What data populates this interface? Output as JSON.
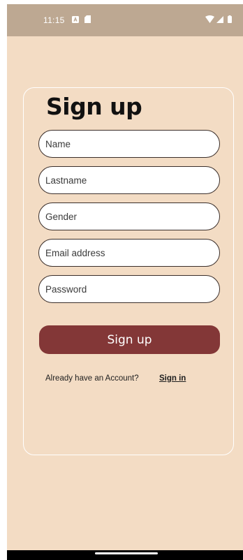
{
  "status_bar": {
    "time": "11:15",
    "icons": [
      "notification-a-icon",
      "sim-card-icon",
      "wifi-icon",
      "cellular-signal-icon",
      "battery-icon"
    ]
  },
  "form": {
    "title": "Sign up",
    "fields": {
      "name": {
        "placeholder": "Name",
        "value": ""
      },
      "lastname": {
        "placeholder": "Lastname",
        "value": ""
      },
      "gender": {
        "placeholder": "Gender",
        "value": ""
      },
      "email": {
        "placeholder": "Email address",
        "value": ""
      },
      "password": {
        "placeholder": "Password",
        "value": ""
      }
    },
    "submit_label": "Sign up",
    "footer_text": "Already have an Account?",
    "signin_label": "Sign in"
  },
  "colors": {
    "background": "#f3dcc4",
    "status_bar": "#bda892",
    "button": "#833737"
  }
}
